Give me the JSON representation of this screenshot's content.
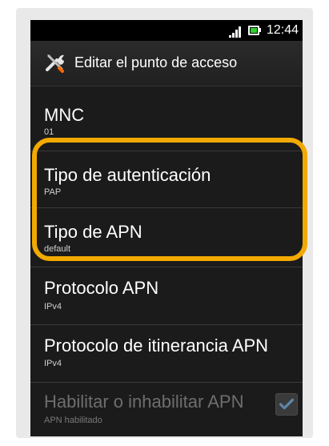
{
  "status_bar": {
    "time": "12:44",
    "signal_icon": "signal-bars-icon",
    "battery_icon": "battery-icon",
    "battery_color": "#32d131"
  },
  "header": {
    "icon": "tools-icon",
    "title": "Editar el punto de acceso"
  },
  "settings": [
    {
      "label": "MNC",
      "value": "01"
    },
    {
      "label": "Tipo de autenticación",
      "value": "PAP"
    },
    {
      "label": "Tipo de APN",
      "value": "default"
    },
    {
      "label": "Protocolo APN",
      "value": "IPv4"
    },
    {
      "label": "Protocolo de itinerancia APN",
      "value": "IPv4"
    },
    {
      "label": "Habilitar o inhabilitar APN",
      "value": "APN habilitado",
      "checked": true,
      "enabled": false
    }
  ],
  "highlight_color": "#f2a900"
}
